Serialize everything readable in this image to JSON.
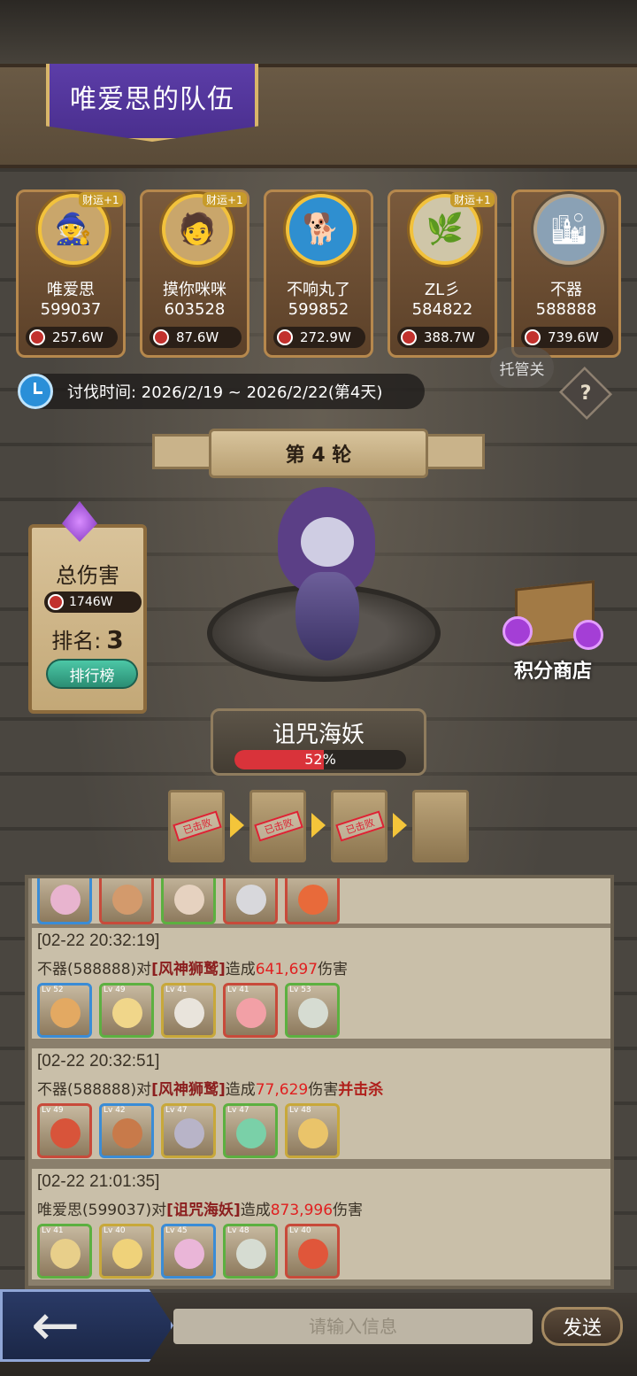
{
  "header": {
    "title": "唯爱思的队伍"
  },
  "members": [
    {
      "name": "唯爱思",
      "score": "599037",
      "damage": "257.6W",
      "badge": "财运+1",
      "icon": "🧙"
    },
    {
      "name": "摸你咪咪",
      "score": "603528",
      "damage": "87.6W",
      "badge": "财运+1",
      "icon": "🧑"
    },
    {
      "name": "不响丸了",
      "score": "599852",
      "damage": "272.9W",
      "badge": "",
      "icon": "🐕"
    },
    {
      "name": "ZL彡",
      "score": "584822",
      "damage": "388.7W",
      "badge": "财运+1",
      "icon": "🌿"
    },
    {
      "name": "不器",
      "score": "588888",
      "damage": "739.6W",
      "badge": "",
      "icon": "🏙"
    }
  ],
  "event": {
    "period": "讨伐时间: 2026/2/19 ~ 2026/2/22(第4天)"
  },
  "controls": {
    "auto_label": "托管关",
    "help": "?"
  },
  "round": {
    "label": "第 4 轮"
  },
  "stats": {
    "total_label": "总伤害",
    "total_damage": "1746W",
    "rank_label": "排名:",
    "rank": "3",
    "ranking_button": "排行榜"
  },
  "shop": {
    "label": "积分商店"
  },
  "boss": {
    "name": "诅咒海妖",
    "hp_percent": 52,
    "hp_text": "52%"
  },
  "stages": [
    {
      "status": "已击败"
    },
    {
      "status": "已击败"
    },
    {
      "status": "已击败"
    },
    {
      "status": ""
    }
  ],
  "log": [
    {
      "time": "[02-22 20:32:19]",
      "attacker": "不器(588888)对",
      "target": "[风神狮鹫]",
      "mid": "造成",
      "amount": "641,697",
      "suffix": "伤害",
      "kill": "",
      "levels": [
        "Lv 52",
        "Lv 49",
        "Lv 41",
        "Lv 41",
        "Lv 53"
      ]
    },
    {
      "time": "[02-22 20:32:51]",
      "attacker": "不器(588888)对",
      "target": "[风神狮鹫]",
      "mid": "造成",
      "amount": "77,629",
      "suffix": "伤害",
      "kill": "并击杀",
      "levels": [
        "Lv 49",
        "Lv 42",
        "Lv 47",
        "Lv 47",
        "Lv 48"
      ]
    },
    {
      "time": "[02-22 21:01:35]",
      "attacker": "唯爱思(599037)对",
      "target": "[诅咒海妖]",
      "mid": "造成",
      "amount": "873,996",
      "suffix": "伤害",
      "kill": "",
      "levels": [
        "Lv 41",
        "Lv 40",
        "Lv 45",
        "Lv 48",
        "Lv 40"
      ]
    }
  ],
  "chat": {
    "placeholder": "请输入信息",
    "send_label": "发送"
  },
  "colors": {
    "accent_purple": "#5c3da8",
    "gold": "#f2c23c",
    "hp_red": "#d9333a",
    "damage_red": "#e02020"
  }
}
